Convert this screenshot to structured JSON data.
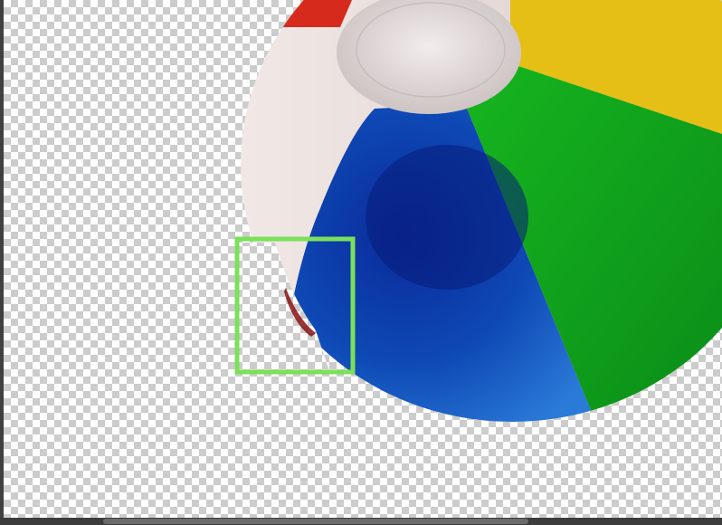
{
  "document": {
    "subject": "beach-ball-layer",
    "layer_transparent": true
  },
  "selection": {
    "tool": "rectangular-marquee",
    "highlight_color": "#7be05a"
  },
  "colors": {
    "workspace": "#535353",
    "ball_white": "#e8dcd9",
    "ball_blue": "#1452b8",
    "ball_green": "#0ea51c",
    "ball_yellow": "#e8c11a",
    "ball_red": "#d62a1c"
  }
}
